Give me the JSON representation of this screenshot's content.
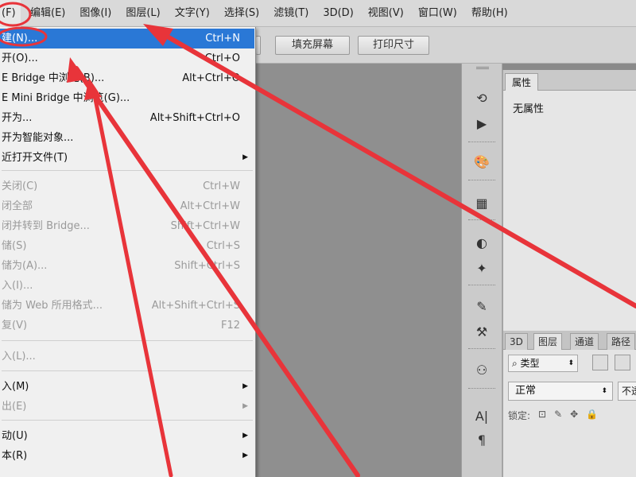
{
  "menubar": {
    "items": [
      "(F)",
      "编辑(E)",
      "图像(I)",
      "图层(L)",
      "文字(Y)",
      "选择(S)",
      "滤镜(T)",
      "3D(D)",
      "视图(V)",
      "窗口(W)",
      "帮助(H)"
    ]
  },
  "options_bar": {
    "fill_screen": "填充屏幕",
    "print_size": "打印尺寸"
  },
  "file_menu": {
    "items": [
      {
        "label": "建(N)...",
        "shortcut": "Ctrl+N"
      },
      {
        "label": "开(O)...",
        "shortcut": "Ctrl+O"
      },
      {
        "label": "E Bridge 中浏览(B)...",
        "shortcut": "Alt+Ctrl+O"
      },
      {
        "label": "E Mini Bridge 中浏览(G)...",
        "shortcut": ""
      },
      {
        "label": "开为...",
        "shortcut": "Alt+Shift+Ctrl+O"
      },
      {
        "label": "开为智能对象...",
        "shortcut": ""
      },
      {
        "label": "近打开文件(T)",
        "shortcut": ""
      },
      {
        "label": "关闭(C)",
        "shortcut": "Ctrl+W"
      },
      {
        "label": "闭全部",
        "shortcut": "Alt+Ctrl+W"
      },
      {
        "label": "闭并转到 Bridge...",
        "shortcut": "Shift+Ctrl+W"
      },
      {
        "label": "储(S)",
        "shortcut": "Ctrl+S"
      },
      {
        "label": "储为(A)...",
        "shortcut": "Shift+Ctrl+S"
      },
      {
        "label": "入(I)...",
        "shortcut": ""
      },
      {
        "label": "储为 Web 所用格式...",
        "shortcut": "Alt+Shift+Ctrl+S"
      },
      {
        "label": "复(V)",
        "shortcut": "F12"
      },
      {
        "label": "入(L)...",
        "shortcut": ""
      },
      {
        "label": "入(M)",
        "shortcut": ""
      },
      {
        "label": "出(E)",
        "shortcut": ""
      },
      {
        "label": "动(U)",
        "shortcut": ""
      },
      {
        "label": "本(R)",
        "shortcut": ""
      }
    ]
  },
  "properties_panel": {
    "tab": "属性",
    "content": "无属性"
  },
  "layers_panel": {
    "tabs": [
      "3D",
      "图层",
      "通道",
      "路径"
    ],
    "filter": "类型",
    "blend_mode": "正常",
    "opacity_label": "不透",
    "lock_label": "锁定:"
  },
  "icons": {
    "submenu_arrow": "triangle-right-icon",
    "search": "search-icon",
    "lock": "lock-icon"
  },
  "colors": {
    "highlight": "#2a78d6",
    "annotation": "#e8343a"
  }
}
